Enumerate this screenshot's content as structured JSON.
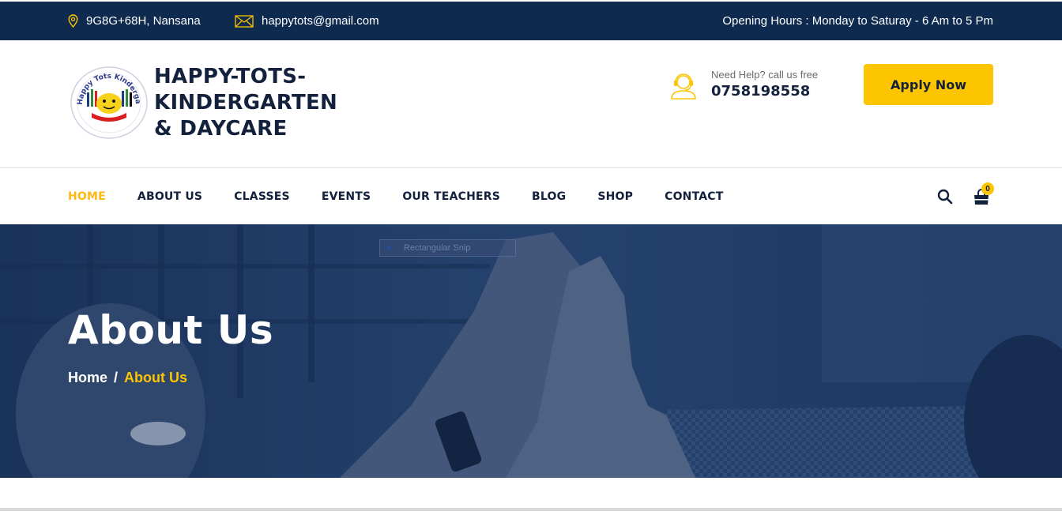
{
  "topbar": {
    "location": "9G8G+68H, Nansana",
    "email": "happytots@gmail.com",
    "hours": "Opening Hours : Monday to Saturay - 6 Am to 5 Pm",
    "icons": {
      "location": "map-pin-icon",
      "email": "envelope-icon"
    },
    "colors": {
      "background": "#0e2a4f",
      "icon": "#fdc500"
    }
  },
  "header": {
    "brand_line1": "HAPPY-TOTS-",
    "brand_line2": "KINDERGARTEN",
    "brand_line3": "& DAYCARE",
    "logo_text": "Happy Tots Kindergarten",
    "help_label": "Need Help? call us free",
    "help_phone": "0758198558",
    "apply_label": "Apply Now",
    "colors": {
      "accent": "#fdc500",
      "text": "#14213d"
    }
  },
  "nav": {
    "items": [
      {
        "label": "HOME",
        "active": true
      },
      {
        "label": "ABOUT US",
        "active": false
      },
      {
        "label": "CLASSES",
        "active": false
      },
      {
        "label": "EVENTS",
        "active": false
      },
      {
        "label": "OUR TEACHERS",
        "active": false
      },
      {
        "label": "BLOG",
        "active": false
      },
      {
        "label": "SHOP",
        "active": false
      },
      {
        "label": "CONTACT",
        "active": false
      }
    ],
    "cart_count": "0",
    "icons": {
      "search": "search-icon",
      "cart": "shopping-bag-icon"
    },
    "colors": {
      "active": "#fdb813"
    }
  },
  "hero": {
    "title": "About Us",
    "breadcrumb_home": "Home",
    "breadcrumb_sep": "/",
    "breadcrumb_current": "About Us",
    "snip_label": "Rectangular Snip",
    "colors": {
      "overlay": "#1c355e",
      "current": "#fdc500"
    }
  }
}
